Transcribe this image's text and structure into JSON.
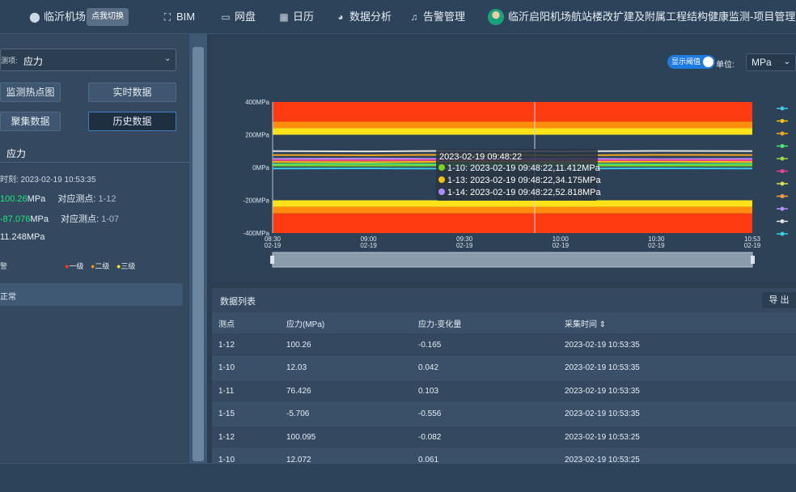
{
  "nav": {
    "airport": "临沂机场",
    "switch_label": "点我切换",
    "bim": "BIM",
    "disk": "网盘",
    "calendar": "日历",
    "analysis": "数据分析",
    "alarm": "告警管理",
    "project_user": "临沂启阳机场航站楼改扩建及附属工程结构健康监测-项目管理员"
  },
  "left": {
    "item_label": "测项:",
    "item_value": "应力",
    "btn_hotspot": "监测热点图",
    "btn_realtime": "实时数据",
    "btn_aggregate": "聚集数据",
    "btn_history": "历史数据",
    "section_title": "应力",
    "time_label": "时刻: 2023-02-19 10:53:35",
    "max_value": "100.26",
    "max_unit": "MPa",
    "max_point_label": "对应测点:",
    "max_point": "1-12",
    "min_value": "-87.076",
    "min_unit": "MPa",
    "min_point_label": "对应测点:",
    "min_point": "1-07",
    "avg_value": "11.248MPa",
    "warn_label": "警",
    "level1": "一级",
    "level2": "二级",
    "level3": "三级",
    "status": "正常"
  },
  "chart_panel": {
    "threshold_toggle": "显示阈值",
    "unit_label": "单位:",
    "unit_value": "MPa",
    "tooltip_time": "2023-02-19 09:48:22",
    "tooltip_rows": [
      {
        "text": "1-10:  2023-02-19 09:48:22,11.412MPa",
        "color": "#7ed321"
      },
      {
        "text": "1-13:  2023-02-19 09:48:22,34.175MPa",
        "color": "#f5c211"
      },
      {
        "text": "1-14:  2023-02-19 09:48:22,52.818MPa",
        "color": "#b18cff"
      }
    ],
    "legend_colors": [
      "#3dc9e8",
      "#f5c211",
      "#f5a623",
      "#4ee07a",
      "#9ad94a",
      "#e84393",
      "#d4e157",
      "#ff9f43",
      "#b18cff",
      "#e0e0e0",
      "#34d1e0"
    ]
  },
  "chart_data": {
    "type": "line",
    "ylim": [
      -400,
      400
    ],
    "y_ticks": [
      "400MPa",
      "200MPa",
      "0MPa",
      "-200MPa",
      "-400MPa"
    ],
    "x_ticks": [
      {
        "time": "08:30",
        "date": "02-19"
      },
      {
        "time": "09:00",
        "date": "02-19"
      },
      {
        "time": "09:30",
        "date": "02-19"
      },
      {
        "time": "10:00",
        "date": "02-19"
      },
      {
        "time": "10:30",
        "date": "02-19"
      },
      {
        "time": "10:53",
        "date": "02-19"
      }
    ],
    "threshold_bands": [
      {
        "from": 280,
        "to": 400,
        "color": "#ff3b12"
      },
      {
        "from": 240,
        "to": 280,
        "color": "#ff8c0a"
      },
      {
        "from": 200,
        "to": 240,
        "color": "#ffe21a"
      },
      {
        "from": -240,
        "to": -200,
        "color": "#ffe21a"
      },
      {
        "from": -280,
        "to": -240,
        "color": "#ff8c0a"
      },
      {
        "from": -400,
        "to": -280,
        "color": "#ff3b12"
      }
    ],
    "series": [
      {
        "values": [
          100,
          98,
          102,
          99,
          101,
          100
        ],
        "color": "#e0e0e0"
      },
      {
        "values": [
          76,
          75,
          78,
          74,
          77,
          76
        ],
        "color": "#f5a623"
      },
      {
        "values": [
          53,
          55,
          52,
          54,
          51,
          53
        ],
        "color": "#b18cff"
      },
      {
        "values": [
          34,
          33,
          35,
          34,
          36,
          34
        ],
        "color": "#f5c211"
      },
      {
        "values": [
          12,
          11,
          13,
          12,
          11,
          12
        ],
        "color": "#7ed321"
      },
      {
        "values": [
          -6,
          -5,
          -7,
          -6,
          -5,
          -6
        ],
        "color": "#3dc9e8"
      },
      {
        "values": [
          20,
          22,
          19,
          21,
          20,
          22
        ],
        "color": "#4ee07a"
      },
      {
        "values": [
          45,
          44,
          46,
          43,
          45,
          44
        ],
        "color": "#e84393"
      }
    ]
  },
  "table": {
    "title": "数据列表",
    "export": "导 出",
    "headers": [
      "测点",
      "应力(MPa)",
      "应力-变化量",
      "采集时间 ⇕"
    ],
    "rows": [
      [
        "1-12",
        "100.26",
        "-0.165",
        "2023-02-19 10:53:35"
      ],
      [
        "1-10",
        "12.03",
        "0.042",
        "2023-02-19 10:53:35"
      ],
      [
        "1-11",
        "76.426",
        "0.103",
        "2023-02-19 10:53:35"
      ],
      [
        "1-15",
        "-5.706",
        "-0.556",
        "2023-02-19 10:53:35"
      ],
      [
        "1-12",
        "100.095",
        "-0.082",
        "2023-02-19 10:53:25"
      ],
      [
        "1-10",
        "12.072",
        "0.061",
        "2023-02-19 10:53:25"
      ]
    ]
  }
}
